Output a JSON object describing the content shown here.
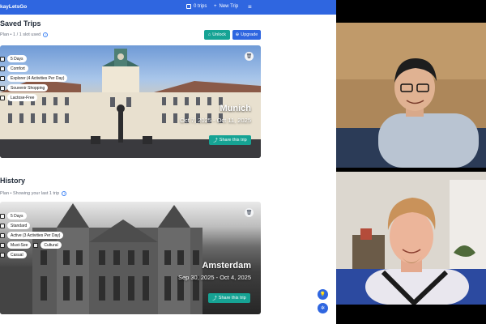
{
  "topbar": {
    "brand": "kayLetsGo",
    "trips_label": "0 trips",
    "new_trip_label": "New Trip",
    "menu_icon": "menu-icon"
  },
  "saved": {
    "title": "Saved Trips",
    "subtitle": "Plan • 1 / 1 slot used",
    "unlock_label": "Unlock",
    "upgrade_label": "Upgrade"
  },
  "history": {
    "title": "History",
    "subtitle": "Plan • Showing your last 1 trip"
  },
  "trips": {
    "munich": {
      "city": "Munich",
      "dates": "Oct 7, 2025 - Oct 11, 2025",
      "share_label": "Share this trip",
      "tags": [
        "5 Days",
        "Comfort",
        "Explorer (4 Activities Per Day)",
        "Souvenir Shopping",
        "Lactose-Free"
      ]
    },
    "amsterdam": {
      "city": "Amsterdam",
      "dates": "Sep 30, 2025 - Oct 4, 2025",
      "share_label": "Share this trip",
      "tags": [
        "5 Days",
        "Standard",
        "Active (3 Activities Per Day)",
        "Must-See",
        "Cultural",
        "Casual"
      ]
    }
  },
  "colors": {
    "primary": "#2f66e0",
    "teal": "#16a394"
  }
}
